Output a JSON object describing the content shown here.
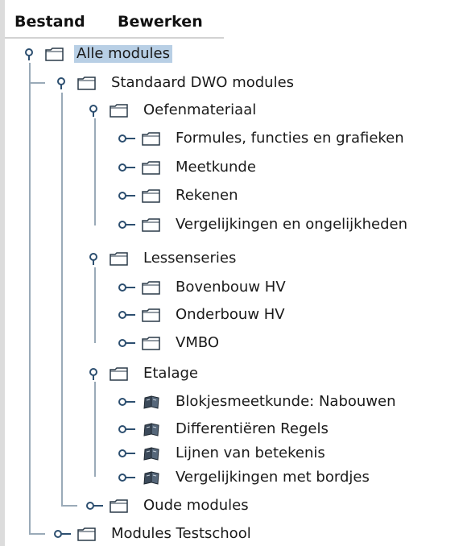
{
  "menubar": {
    "file_label": "Bestand",
    "edit_label": "Bewerken"
  },
  "tree": {
    "root": "Alle modules",
    "standard": "Standaard DWO modules",
    "oefenmateriaal": "Oefenmateriaal",
    "formules": "Formules, functies en grafieken",
    "meetkunde": "Meetkunde",
    "rekenen": "Rekenen",
    "vergelijkingen_ongelijkheden": "Vergelijkingen en ongelijkheden",
    "lessenseries": "Lessenseries",
    "bovenbouw": "Bovenbouw HV",
    "onderbouw": "Onderbouw HV",
    "vmbo": "VMBO",
    "etalage": "Etalage",
    "blokjes": "Blokjesmeetkunde: Nabouwen",
    "differentieren": "Differentiëren Regels",
    "lijnen": "Lijnen van betekenis",
    "vergelijkingen_bordjes": "Vergelijkingen met bordjes",
    "oude": "Oude modules",
    "testschool": "Modules Testschool"
  },
  "icons": {
    "folder": "folder-icon",
    "book": "book-icon",
    "expanded": "expanded-handle-icon",
    "collapsed": "collapsed-handle-icon"
  },
  "colors": {
    "selection": "#b8cfe5",
    "tree_line": "#9aaab8",
    "handle": "#2d4f70",
    "folder_stroke": "#2a3a48"
  }
}
